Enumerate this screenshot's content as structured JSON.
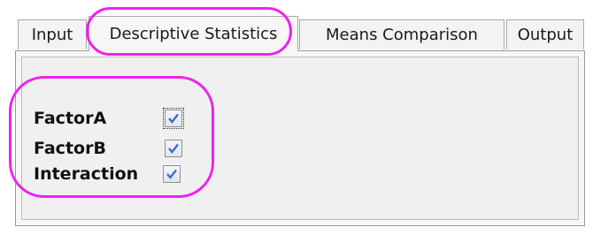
{
  "tabs": [
    {
      "label": "Input",
      "active": false
    },
    {
      "label": "Descriptive Statistics",
      "active": true
    },
    {
      "label": "Means Comparison",
      "active": false
    },
    {
      "label": "Output",
      "active": false
    }
  ],
  "options": [
    {
      "label": "FactorA",
      "checked": true,
      "focused": true
    },
    {
      "label": "FactorB",
      "checked": true,
      "focused": false
    },
    {
      "label": "Interaction",
      "checked": true,
      "focused": false
    }
  ],
  "colors": {
    "highlight": "#ee22ee",
    "check": "#3a6fc4",
    "panel_background": "#f0f0f0"
  },
  "icons": {
    "checkmark": "checkmark-icon"
  }
}
